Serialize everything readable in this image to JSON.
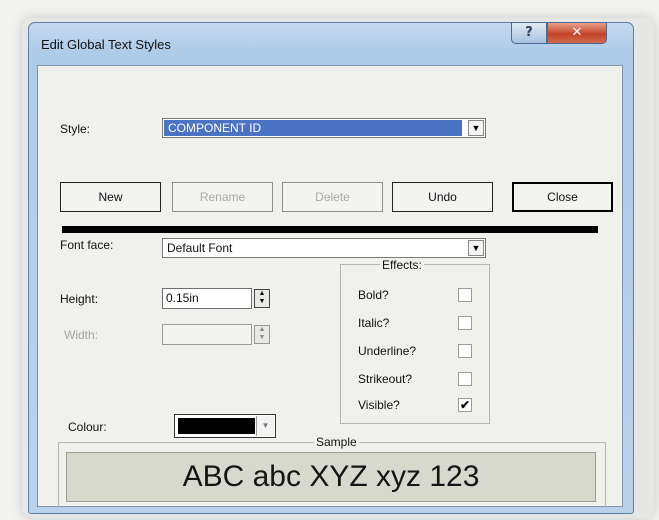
{
  "window": {
    "title": "Edit Global Text Styles",
    "help_label": "?",
    "close_label": "✕"
  },
  "style": {
    "label": "Style:",
    "value": "COMPONENT ID"
  },
  "buttons": {
    "new": "New",
    "rename": "Rename",
    "delete": "Delete",
    "undo": "Undo",
    "close": "Close"
  },
  "font": {
    "label": "Font face:",
    "value": "Default Font"
  },
  "height": {
    "label": "Height:",
    "value": "0.15in"
  },
  "width": {
    "label": "Width:",
    "value": ""
  },
  "colour": {
    "label": "Colour:",
    "swatch_color": "#000000"
  },
  "effects": {
    "title": "Effects:",
    "items": [
      {
        "label": "Bold?",
        "checked": false
      },
      {
        "label": "Italic?",
        "checked": false
      },
      {
        "label": "Underline?",
        "checked": false
      },
      {
        "label": "Strikeout?",
        "checked": false
      },
      {
        "label": "Visible?",
        "checked": true
      }
    ]
  },
  "sample": {
    "title": "Sample",
    "text": "ABC abc XYZ xyz 123"
  },
  "glyphs": {
    "down": "▼",
    "up": "▲",
    "check": "✔"
  }
}
